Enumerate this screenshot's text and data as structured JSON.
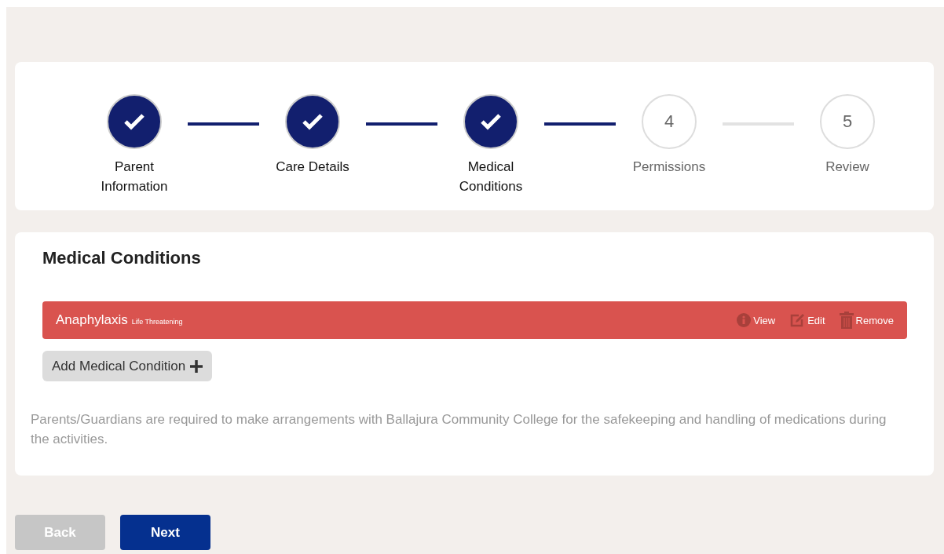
{
  "steps": [
    {
      "label": "Parent Information",
      "completed": true
    },
    {
      "label": "Care Details",
      "completed": true
    },
    {
      "label": "Medical Conditions",
      "completed": true
    },
    {
      "number": "4",
      "label": "Permissions",
      "completed": false
    },
    {
      "number": "5",
      "label": "Review",
      "completed": false
    }
  ],
  "section": {
    "title": "Medical Conditions",
    "conditions": [
      {
        "name": "Anaphylaxis",
        "severity": "Life Threatening",
        "actions": [
          {
            "kind": "view",
            "label": "View"
          },
          {
            "kind": "edit",
            "label": "Edit"
          },
          {
            "kind": "remove",
            "label": "Remove"
          }
        ]
      }
    ],
    "add_button": "Add Medical Condition",
    "note": "Parents/Guardians are required to make arrangements with Ballajura Community College for the safekeeping and handling of medications during the activities."
  },
  "buttons": [
    {
      "label": "Back",
      "disabled": true
    },
    {
      "label": "Next",
      "disabled": false
    }
  ]
}
